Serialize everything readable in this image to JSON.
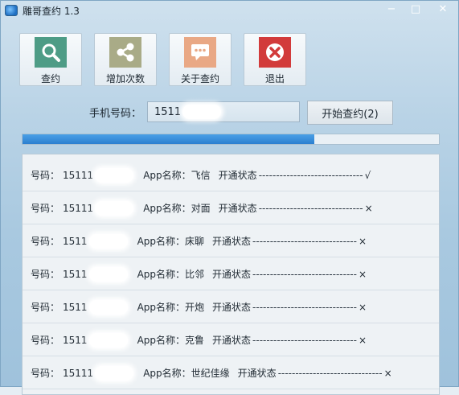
{
  "window": {
    "title": "雕哥查约 1.3",
    "controls": {
      "minimize": "−",
      "maximize": "□",
      "close": "✕"
    }
  },
  "toolbar": {
    "items": [
      {
        "label": "查约",
        "icon": "search-icon",
        "color": "#4e9c86"
      },
      {
        "label": "增加次数",
        "icon": "share-icon",
        "color": "#a9ab87"
      },
      {
        "label": "关于查约",
        "icon": "chat-bubble-icon",
        "color": "#e9a885"
      },
      {
        "label": "退出",
        "icon": "close-x-icon",
        "color": "#d23b3b"
      }
    ]
  },
  "phone": {
    "label": "手机号码：",
    "value": "1511"
  },
  "start_button": {
    "label": "开始查约(2)"
  },
  "progress": {
    "percent": 70
  },
  "results": {
    "number_label": "号码：",
    "app_label": "App名称：",
    "status_label": "开通状态",
    "rows": [
      {
        "number": "15111",
        "app": "飞信",
        "dashes": "------------------------------",
        "result": "√"
      },
      {
        "number": "15111",
        "app": "对面",
        "dashes": "------------------------------",
        "result": "×"
      },
      {
        "number": "1511",
        "app": "床聊",
        "dashes": "------------------------------",
        "result": "×"
      },
      {
        "number": "1511",
        "app": "比邻",
        "dashes": "------------------------------",
        "result": "×"
      },
      {
        "number": "1511",
        "app": "开炮",
        "dashes": "------------------------------",
        "result": "×"
      },
      {
        "number": "1511",
        "app": "克鲁",
        "dashes": "------------------------------",
        "result": "×"
      },
      {
        "number": "15111",
        "app": "世纪佳缘",
        "dashes": "------------------------------",
        "result": "×"
      }
    ]
  }
}
